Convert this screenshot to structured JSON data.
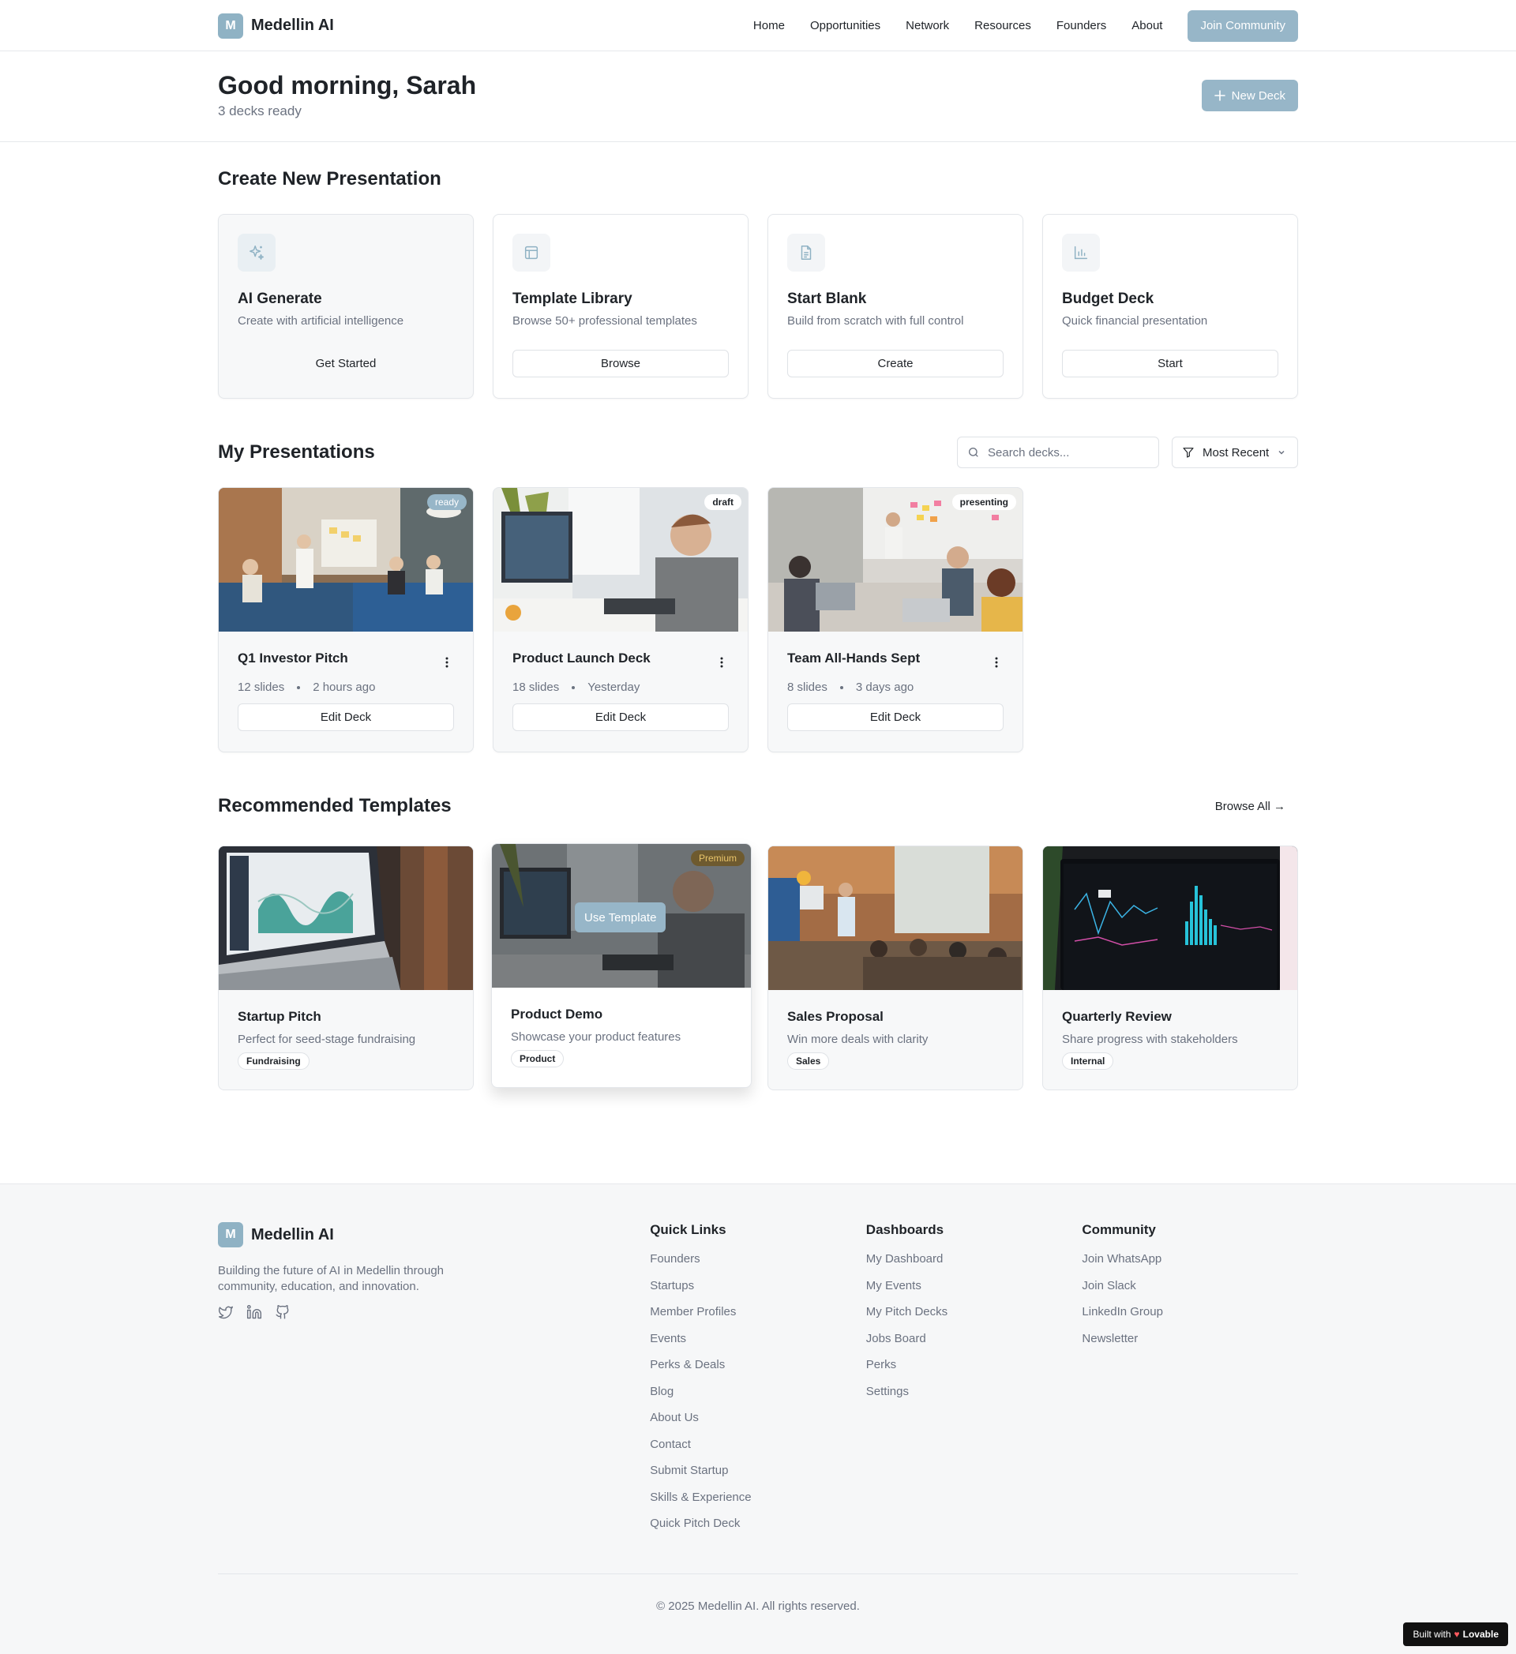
{
  "brand": {
    "logo_letter": "M",
    "name": "Medellin AI"
  },
  "nav": {
    "links": [
      "Home",
      "Opportunities",
      "Network",
      "Resources",
      "Founders",
      "About"
    ],
    "join_label": "Join Community"
  },
  "greeting": {
    "title": "Good morning, Sarah",
    "subtitle": "3 decks ready",
    "new_deck_label": "New Deck"
  },
  "create": {
    "title": "Create New Presentation",
    "cards": [
      {
        "icon": "sparkles-icon",
        "title": "AI Generate",
        "desc": "Create with artificial intelligence",
        "button": "Get Started"
      },
      {
        "icon": "layout-icon",
        "title": "Template Library",
        "desc": "Browse 50+ professional templates",
        "button": "Browse"
      },
      {
        "icon": "file-icon",
        "title": "Start Blank",
        "desc": "Build from scratch with full control",
        "button": "Create"
      },
      {
        "icon": "bar-chart-icon",
        "title": "Budget Deck",
        "desc": "Quick financial presentation",
        "button": "Start"
      }
    ]
  },
  "presentations": {
    "title": "My Presentations",
    "search_placeholder": "Search decks...",
    "sort_label": "Most Recent",
    "items": [
      {
        "title": "Q1 Investor Pitch",
        "slides": "12 slides",
        "time": "2 hours ago",
        "status": "ready",
        "button": "Edit Deck"
      },
      {
        "title": "Product Launch Deck",
        "slides": "18 slides",
        "time": "Yesterday",
        "status": "draft",
        "button": "Edit Deck"
      },
      {
        "title": "Team All-Hands Sept",
        "slides": "8 slides",
        "time": "3 days ago",
        "status": "presenting",
        "button": "Edit Deck"
      }
    ]
  },
  "templates": {
    "title": "Recommended Templates",
    "browse_all": "Browse All →",
    "premium_label": "Premium",
    "use_label": "Use Template",
    "items": [
      {
        "title": "Startup Pitch",
        "desc": "Perfect for seed-stage fundraising",
        "tag": "Fundraising"
      },
      {
        "title": "Product Demo",
        "desc": "Showcase your product features",
        "tag": "Product"
      },
      {
        "title": "Sales Proposal",
        "desc": "Win more deals with clarity",
        "tag": "Sales"
      },
      {
        "title": "Quarterly Review",
        "desc": "Share progress with stakeholders",
        "tag": "Internal"
      }
    ]
  },
  "footer": {
    "description": "Building the future of AI in Medellin through community, education, and innovation.",
    "quick_links": {
      "title": "Quick Links",
      "items": [
        "Founders",
        "Startups",
        "Member Profiles",
        "Events",
        "Perks & Deals",
        "Blog",
        "About Us",
        "Contact",
        "Submit Startup",
        "Skills & Experience",
        "Quick Pitch Deck"
      ]
    },
    "dashboards": {
      "title": "Dashboards",
      "items": [
        "My Dashboard",
        "My Events",
        "My Pitch Decks",
        "Jobs Board",
        "Perks",
        "Settings"
      ]
    },
    "community": {
      "title": "Community",
      "items": [
        "Join WhatsApp",
        "Join Slack",
        "LinkedIn Group",
        "Newsletter"
      ]
    },
    "copyright": "© 2025 Medellin AI. All rights reserved."
  },
  "lovable": {
    "prefix": "Built with",
    "name": "Lovable"
  },
  "colors": {
    "accent": "#97b6c8",
    "text": "#1f2328",
    "muted": "#6b7280"
  }
}
